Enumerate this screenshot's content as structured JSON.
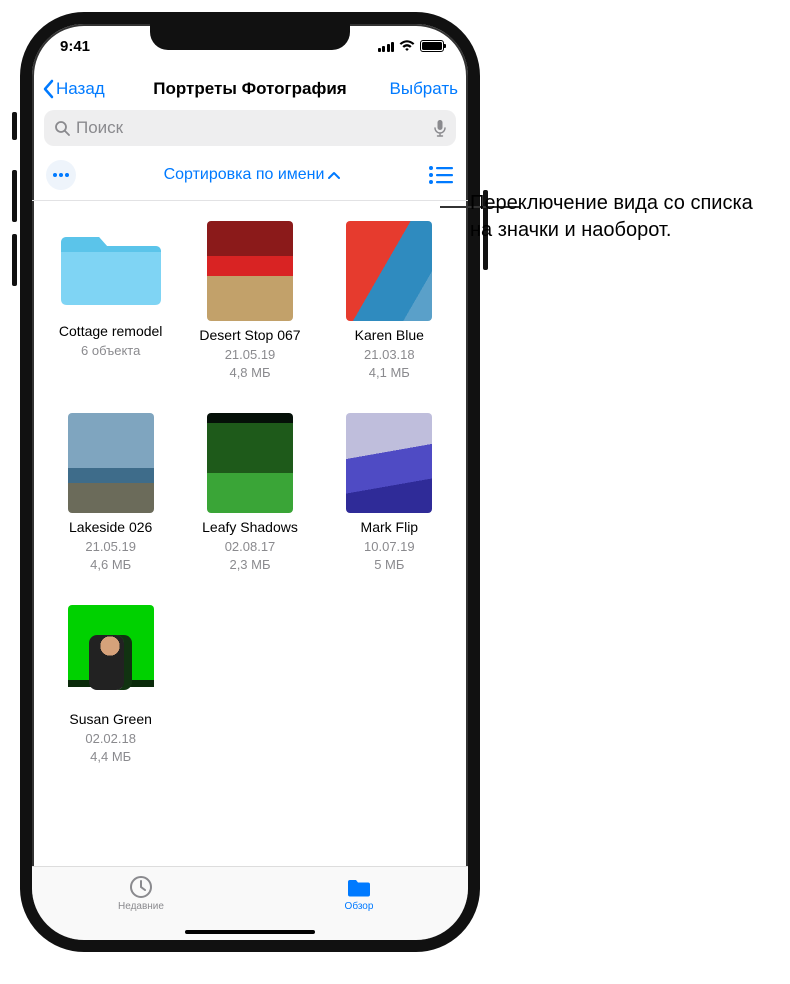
{
  "status": {
    "time": "9:41"
  },
  "nav": {
    "back": "Назад",
    "title": "Портреты Фотография",
    "select": "Выбрать"
  },
  "search": {
    "placeholder": "Поиск"
  },
  "sort": {
    "label": "Сортировка по имени"
  },
  "icons": {
    "more": "more-icon",
    "list_toggle": "list-toggle-icon",
    "search": "search-icon",
    "mic": "mic-icon",
    "chevron_up": "chevron-up-icon",
    "chevron_left": "chevron-left-icon"
  },
  "items": [
    {
      "kind": "folder",
      "name": "Cottage remodel",
      "meta1": "6 объекта",
      "meta2": ""
    },
    {
      "kind": "file",
      "name": "Desert Stop 067",
      "meta1": "21.05.19",
      "meta2": "4,8 МБ"
    },
    {
      "kind": "file",
      "name": "Karen Blue",
      "meta1": "21.03.18",
      "meta2": "4,1 МБ"
    },
    {
      "kind": "file",
      "name": "Lakeside 026",
      "meta1": "21.05.19",
      "meta2": "4,6 МБ"
    },
    {
      "kind": "file",
      "name": "Leafy Shadows",
      "meta1": "02.08.17",
      "meta2": "2,3 МБ"
    },
    {
      "kind": "file",
      "name": "Mark Flip",
      "meta1": "10.07.19",
      "meta2": "5 МБ"
    },
    {
      "kind": "file",
      "name": "Susan Green",
      "meta1": "02.02.18",
      "meta2": "4,4 МБ"
    }
  ],
  "tabs": {
    "recents": "Недавние",
    "browse": "Обзор"
  },
  "callout": {
    "text": "Переключение вида со списка на значки и наоборот."
  }
}
